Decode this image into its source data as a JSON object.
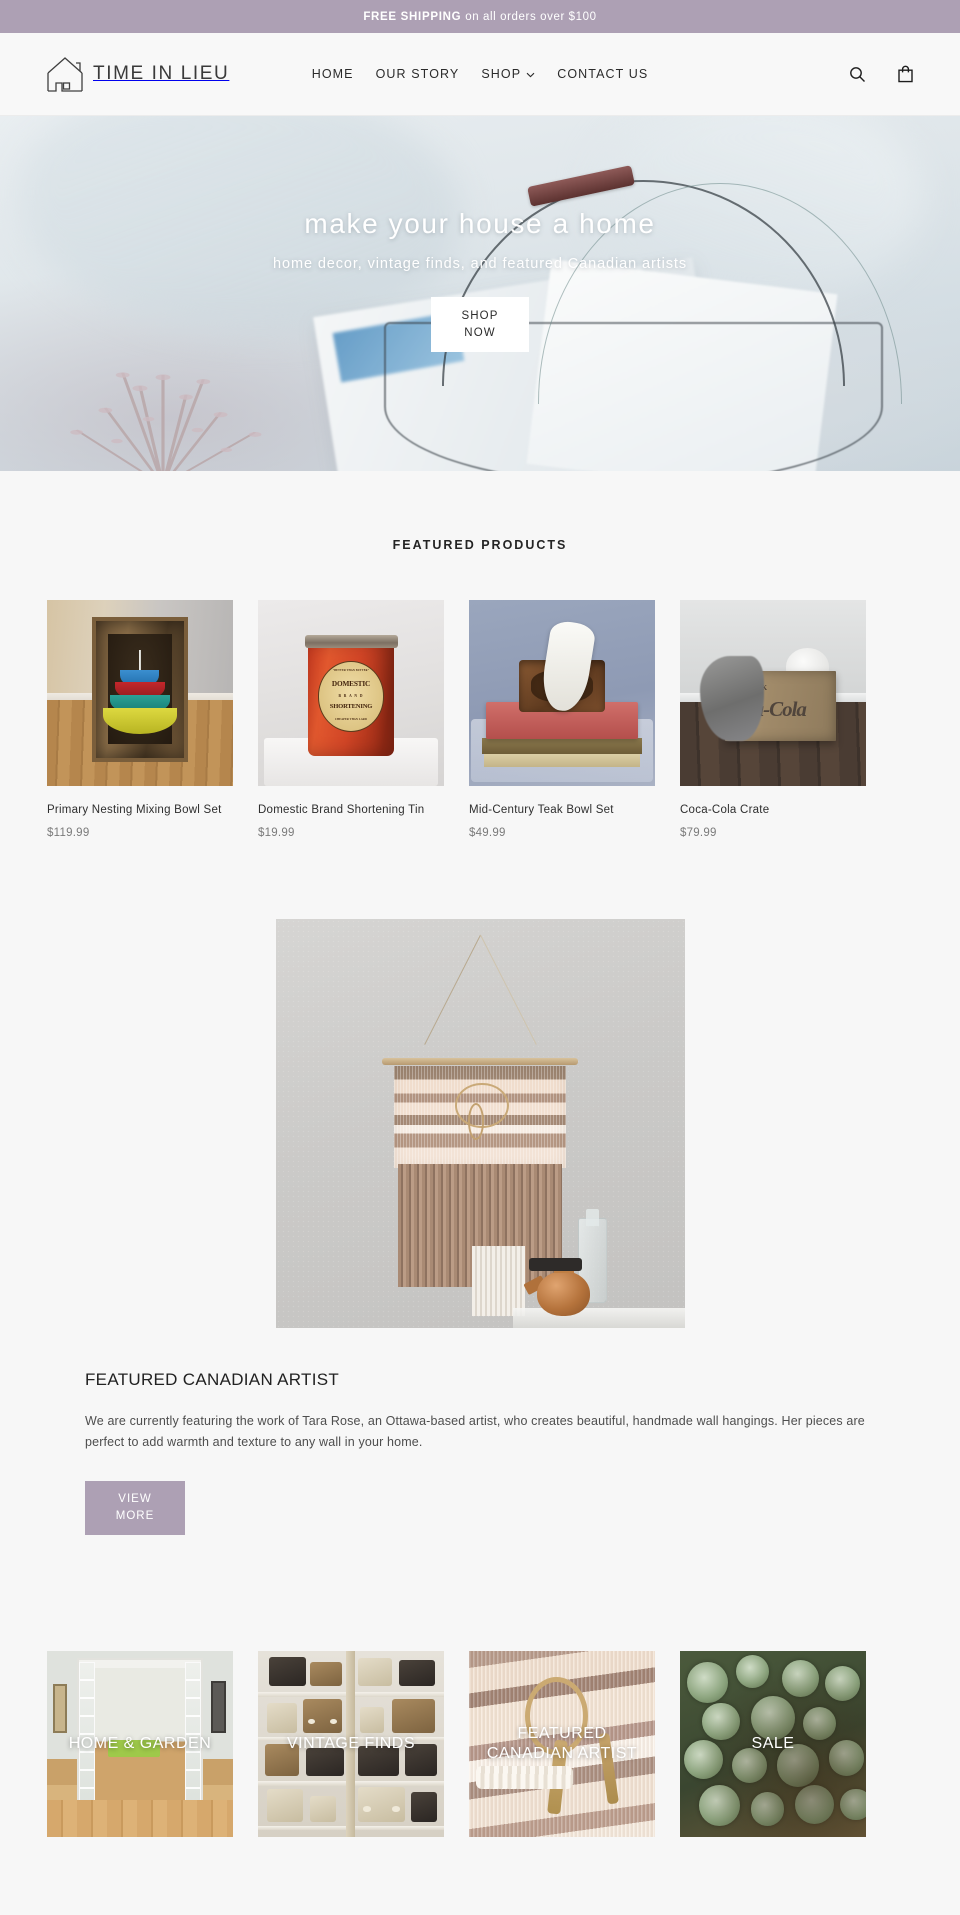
{
  "announcement": {
    "bold_text": "FREE SHIPPING",
    "rest_text": "on all orders over  $100"
  },
  "header": {
    "brand_name": "TIME IN LIEU",
    "logo_icon": "house-outline-icon",
    "nav": [
      {
        "label": "HOME",
        "has_dropdown": false
      },
      {
        "label": "OUR STORY",
        "has_dropdown": false
      },
      {
        "label": "SHOP",
        "has_dropdown": true,
        "chevron": "⌄"
      },
      {
        "label": "CONTACT US",
        "has_dropdown": false
      }
    ],
    "actions": [
      {
        "name": "search-icon",
        "label": "Search"
      },
      {
        "name": "cart-icon",
        "label": "Cart"
      }
    ]
  },
  "hero": {
    "title": "make your house a home",
    "subtitle": "home decor, vintage finds, and featured Canadian artists",
    "button_line1": "SHOP",
    "button_line2": "NOW",
    "image_alt": "wire basket with newspapers and heather plant"
  },
  "featured": {
    "section_title": "FEATURED PRODUCTS",
    "products": [
      {
        "title": "Primary Nesting Mixing Bowl Set",
        "price": "$119.99",
        "image_alt": "four colored nesting bowls in a wooden crate"
      },
      {
        "title": "Domestic Brand Shortening Tin",
        "price": "$19.99",
        "image_alt": "vintage red shortening tin",
        "tin_label": {
          "top": "\"BETTER THAN BUTTER\"",
          "line1": "DOMESTIC",
          "line2": "B R A N D",
          "line3": "SHORTENING",
          "bottom": "CHEAPER THAN LARD"
        }
      },
      {
        "title": "Mid-Century Teak Bowl Set",
        "price": "$49.99",
        "image_alt": "teak bowl with measuring spoons on books"
      },
      {
        "title": "Coca-Cola Crate",
        "price": "$79.99",
        "image_alt": "wooden Coca-Cola crate with gray blanket",
        "crate_text_top": "DRINK",
        "crate_text_main": "Coca-Cola"
      }
    ]
  },
  "artist": {
    "image_alt": "woven wall hanging with copper kettle and glass bottle",
    "heading": "FEATURED CANADIAN ARTIST",
    "body": "We are currently featuring the work of Tara Rose, an Ottawa-based artist, who creates beautiful, handmade wall hangings. Her pieces are perfect to add warmth and texture to any wall in your home.",
    "button_line1": "VIEW",
    "button_line2": "MORE"
  },
  "categories": [
    {
      "label": "HOME & GARDEN",
      "image_alt": "french doors opening to bright living room"
    },
    {
      "label": "VINTAGE FINDS",
      "image_alt": "shelves of vintage radios"
    },
    {
      "label": "FEATURED CANADIAN ARTIST",
      "image_alt": "close-up of woven textile"
    },
    {
      "label": "SALE",
      "image_alt": "green succulents"
    }
  ],
  "colors": {
    "accent_mauve": "#ada0b4",
    "page_background": "#f7f7f7",
    "header_background": "#f8f8f8",
    "text_dark": "#2b2b2b",
    "text_muted": "#7b7b7b"
  }
}
